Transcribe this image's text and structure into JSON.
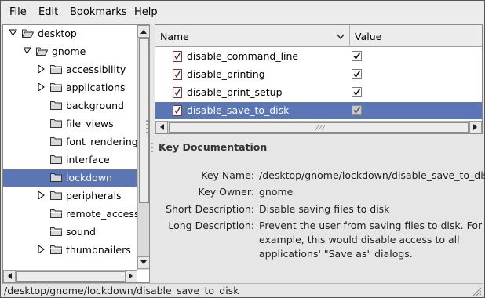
{
  "menubar": {
    "file": "File",
    "edit": "Edit",
    "bookmarks": "Bookmarks",
    "help": "Help"
  },
  "tree": [
    {
      "label": "desktop",
      "expanded": true
    },
    {
      "label": "gnome",
      "expanded": true
    },
    {
      "label": "accessibility",
      "expandable": true
    },
    {
      "label": "applications",
      "expandable": true
    },
    {
      "label": "background"
    },
    {
      "label": "file_views"
    },
    {
      "label": "font_rendering"
    },
    {
      "label": "interface"
    },
    {
      "label": "lockdown",
      "selected": true
    },
    {
      "label": "peripherals",
      "expandable": true
    },
    {
      "label": "remote_access"
    },
    {
      "label": "sound"
    },
    {
      "label": "thumbnailers",
      "expandable": true
    }
  ],
  "keys_table": {
    "col_name": "Name",
    "col_value": "Value",
    "rows": [
      {
        "name": "disable_command_line",
        "checked": true
      },
      {
        "name": "disable_printing",
        "checked": true
      },
      {
        "name": "disable_print_setup",
        "checked": true
      },
      {
        "name": "disable_save_to_disk",
        "checked": true,
        "selected": true
      }
    ]
  },
  "doc": {
    "title": "Key Documentation",
    "key_name_label": "Key Name:",
    "key_name": "/desktop/gnome/lockdown/disable_save_to_disk",
    "key_owner_label": "Key Owner:",
    "key_owner": "gnome",
    "short_desc_label": "Short Description:",
    "short_desc": "Disable saving files to disk",
    "long_desc_label": "Long Description:",
    "long_desc": "Prevent the user from saving files to disk. For example, this would disable access to all applications' \"Save as\" dialogs."
  },
  "status": {
    "path": "/desktop/gnome/lockdown/disable_save_to_disk"
  }
}
